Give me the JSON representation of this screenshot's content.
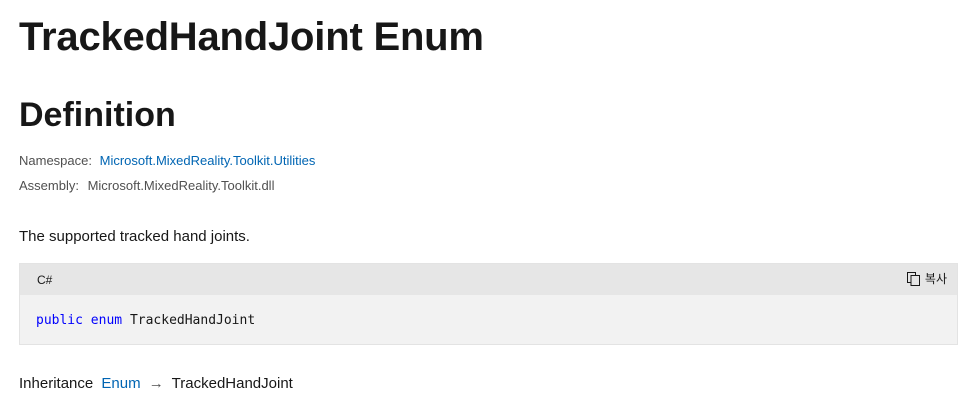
{
  "page": {
    "title": "TrackedHandJoint Enum"
  },
  "definition": {
    "heading": "Definition",
    "namespace_label": "Namespace:",
    "namespace_value": "Microsoft.MixedReality.Toolkit.Utilities",
    "assembly_label": "Assembly:",
    "assembly_value": "Microsoft.MixedReality.Toolkit.dll",
    "summary": "The supported tracked hand joints."
  },
  "code_block": {
    "language": "C#",
    "copy_label": "복사",
    "copy_icon": "copy-icon",
    "tokens": {
      "kw_public": "public",
      "kw_enum": "enum",
      "identifier": "TrackedHandJoint"
    },
    "keyword_color": "#0101fd"
  },
  "inheritance": {
    "label": "Inheritance",
    "base": "Enum",
    "arrow": "→",
    "current": "TrackedHandJoint"
  },
  "colors": {
    "link": "#0065b3",
    "text": "#171717",
    "muted": "#505050",
    "code_header_bg": "#e6e6e6",
    "code_body_bg": "#f2f2f2"
  }
}
